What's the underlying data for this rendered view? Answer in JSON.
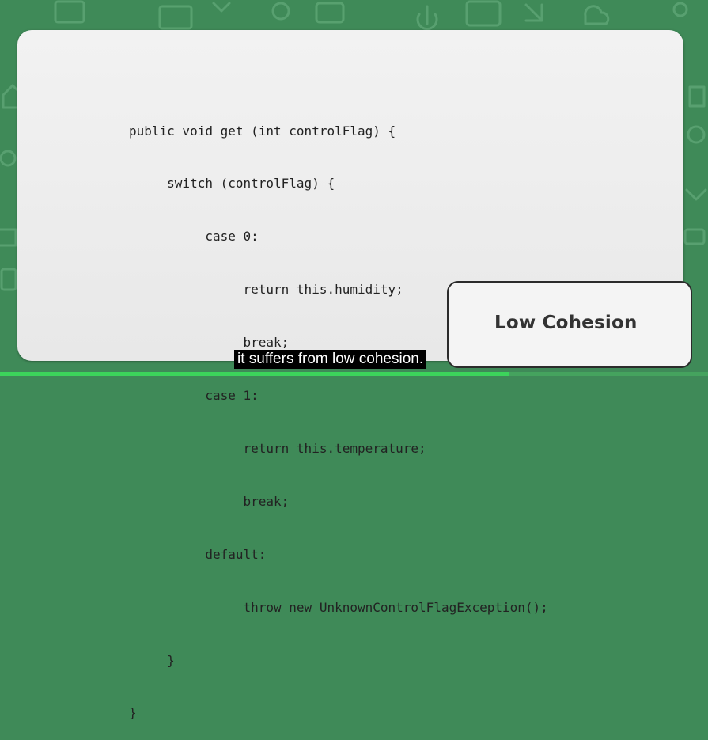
{
  "code": {
    "lines": [
      "public void get (int controlFlag) {",
      "     switch (controlFlag) {",
      "          case 0:",
      "               return this.humidity;",
      "               break;",
      "          case 1:",
      "               return this.temperature;",
      "               break;",
      "          default:",
      "               throw new UnknownControlFlagException();",
      "     }",
      "}"
    ]
  },
  "label": {
    "text": "Low Cohesion"
  },
  "caption": {
    "text": "it suffers from low cohesion."
  },
  "video": {
    "progress_fraction": 0.72
  },
  "colors": {
    "background": "#3f8a58",
    "card": "#efefef",
    "progress": "#3cd45b"
  }
}
